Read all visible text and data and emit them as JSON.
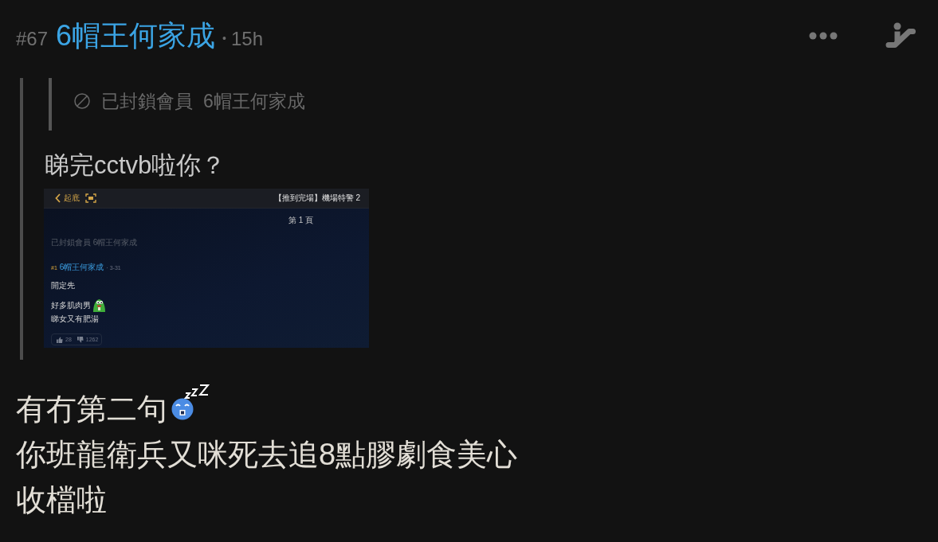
{
  "post": {
    "number": "#67",
    "author": "6帽王何家成",
    "separator": "•",
    "time": "15h"
  },
  "quote": {
    "nested": {
      "label": "已封鎖會員",
      "author": "6帽王何家成"
    },
    "text": "睇完cctvb啦你？",
    "screenshot": {
      "back_label": "起底",
      "thread_title": "【推到完場】機場特警 2",
      "page_label": "第 1 頁",
      "blocked_notice": "已封鎖會員 6帽王何家成",
      "reply": {
        "number": "#1",
        "author": "6帽王何家成",
        "separator": "·",
        "date": "3-31"
      },
      "lines": [
        {
          "kind": "text",
          "text": "開定先"
        },
        {
          "kind": "text_emoji",
          "text": "好多肌肉男"
        },
        {
          "kind": "text",
          "text": "睇女又有肥湯"
        }
      ],
      "likes": "28",
      "dislikes": "1262"
    }
  },
  "body": {
    "lines": [
      {
        "kind": "text_emoji",
        "text": "有冇第二句"
      },
      {
        "kind": "text",
        "text": "你班龍衛兵又咪死去追8點膠劇食美心"
      },
      {
        "kind": "text",
        "text": "收檔啦"
      }
    ]
  }
}
